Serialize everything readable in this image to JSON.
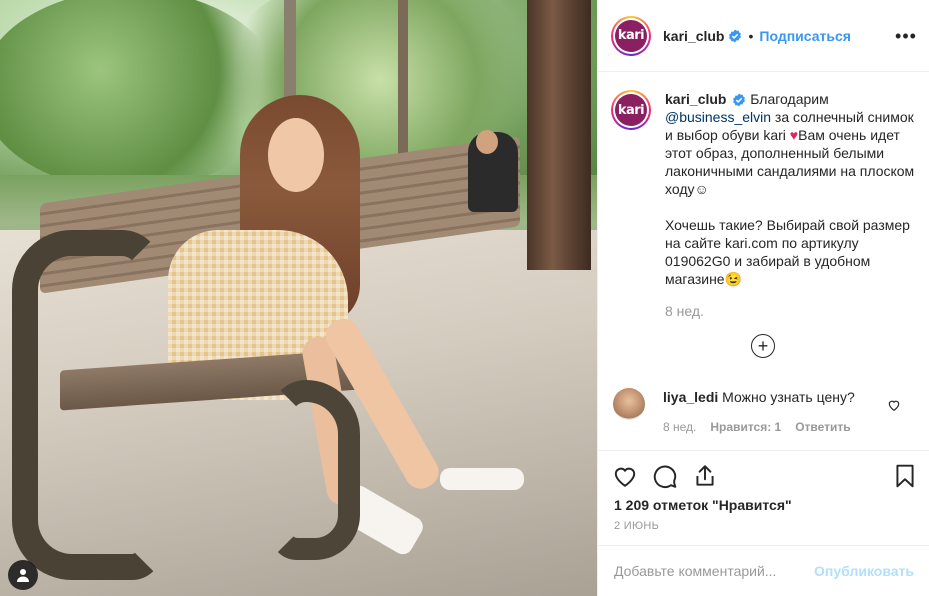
{
  "post": {
    "account": {
      "username": "kari_club",
      "avatar_text": "kari",
      "follow_label": "Подписаться",
      "dot": "•",
      "more_label": "•••"
    },
    "caption": {
      "username": "kari_club",
      "line1": " Благодарим ",
      "mention": "@business_elvin",
      "line2": " за солнечный снимок и выбор обуви kari ",
      "heart": "♥",
      "line3": "Вам очень идет этот образ, дополненный белыми лаконичными сандалиями на плоском ходу☺",
      "line4": "Хочешь такие? Выбирай свой размер на сайте kari.com по артикулу 019062G0 и забирай в удобном магазине",
      "smile": "😉",
      "time": "8 нед."
    },
    "load_more": "+",
    "comment": {
      "username": "liya_ledi",
      "text": "Можно узнать цену?",
      "time": "8 нед.",
      "likes": "Нравится: 1",
      "reply": "Ответить"
    },
    "likes_count": "1 209 отметок \"Нравится\"",
    "date": "2 ИЮНЬ",
    "add_comment_placeholder": "Добавьте комментарий...",
    "publish_label": "Опубликовать"
  },
  "colors": {
    "accent": "#3897f0",
    "brand": "#8a1f61",
    "muted": "#999999",
    "text": "#262626"
  }
}
